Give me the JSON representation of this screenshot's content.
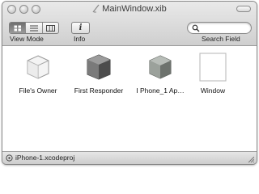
{
  "window": {
    "title": "MainWindow.xib"
  },
  "toolbar": {
    "view_mode_label": "View Mode",
    "info_label": "Info",
    "info_button_glyph": "i",
    "search_label": "Search Field",
    "search_placeholder": ""
  },
  "objects": [
    {
      "label": "File's Owner",
      "icon": "cube-outline-icon"
    },
    {
      "label": "First Responder",
      "icon": "cube-dark-icon"
    },
    {
      "label": "I Phone_1 Ap…",
      "icon": "cube-green-icon"
    },
    {
      "label": "Window",
      "icon": "window-icon"
    }
  ],
  "status": {
    "project": "iPhone-1.xcodeproj"
  }
}
